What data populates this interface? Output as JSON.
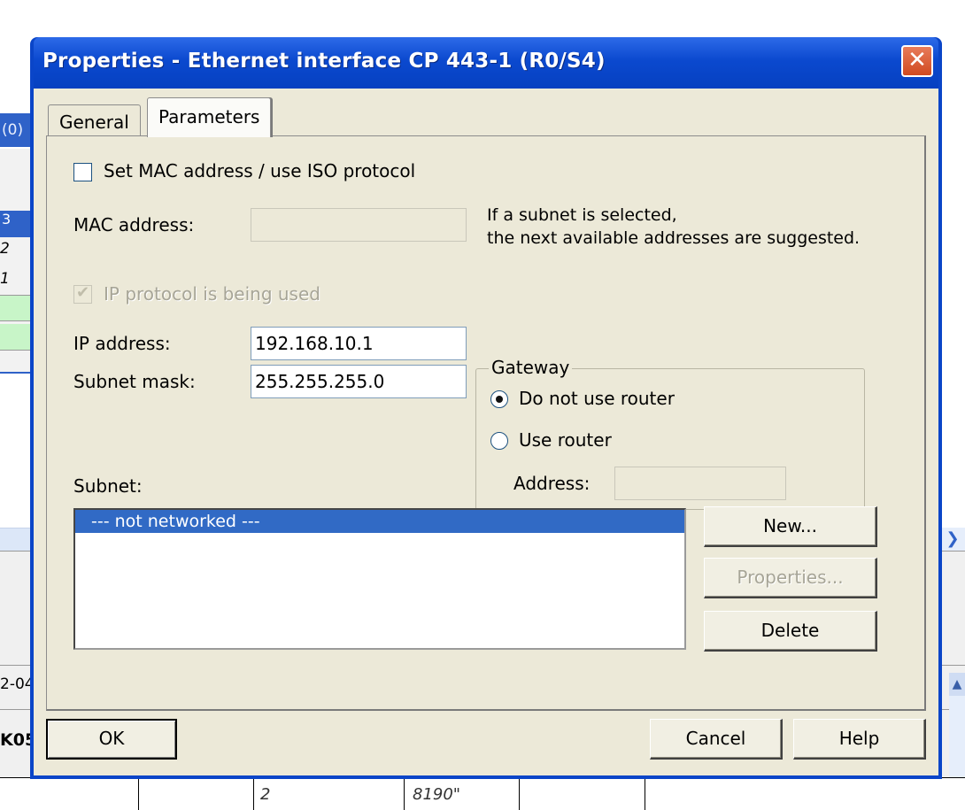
{
  "background": {
    "left_title": "(0)",
    "left_rows": [
      "3",
      "2",
      "1"
    ],
    "lower_labels": [
      "2-04",
      "K05"
    ],
    "bottom_cells": [
      "2",
      "8190\""
    ]
  },
  "dialog": {
    "title": "Properties - Ethernet interface  CP 443-1 (R0/S4)",
    "close_glyph": "✕",
    "tabs": [
      {
        "label": "General",
        "active": false
      },
      {
        "label": "Parameters",
        "active": true
      }
    ],
    "mac": {
      "checkbox_label": "Set MAC address / use ISO protocol",
      "checked": false,
      "address_label": "MAC address:",
      "address_value": "",
      "hint_line1": "If a subnet is selected,",
      "hint_line2": "the next available addresses are suggested."
    },
    "ip": {
      "checkbox_label": "IP protocol is being used",
      "checked": true,
      "address_label": "IP address:",
      "address_value": "192.168.10.1",
      "mask_label": "Subnet mask:",
      "mask_value": "255.255.255.0"
    },
    "gateway": {
      "legend": "Gateway",
      "option_no_router": "Do not use router",
      "option_use_router": "Use router",
      "selected": "no_router",
      "address_label": "Address:",
      "address_value": ""
    },
    "subnet": {
      "label": "Subnet:",
      "items": [
        "--- not networked ---"
      ],
      "selected_index": 0,
      "new_button": "New...",
      "properties_button": "Properties...",
      "delete_button": "Delete"
    },
    "footer": {
      "ok": "OK",
      "cancel": "Cancel",
      "help": "Help"
    }
  }
}
